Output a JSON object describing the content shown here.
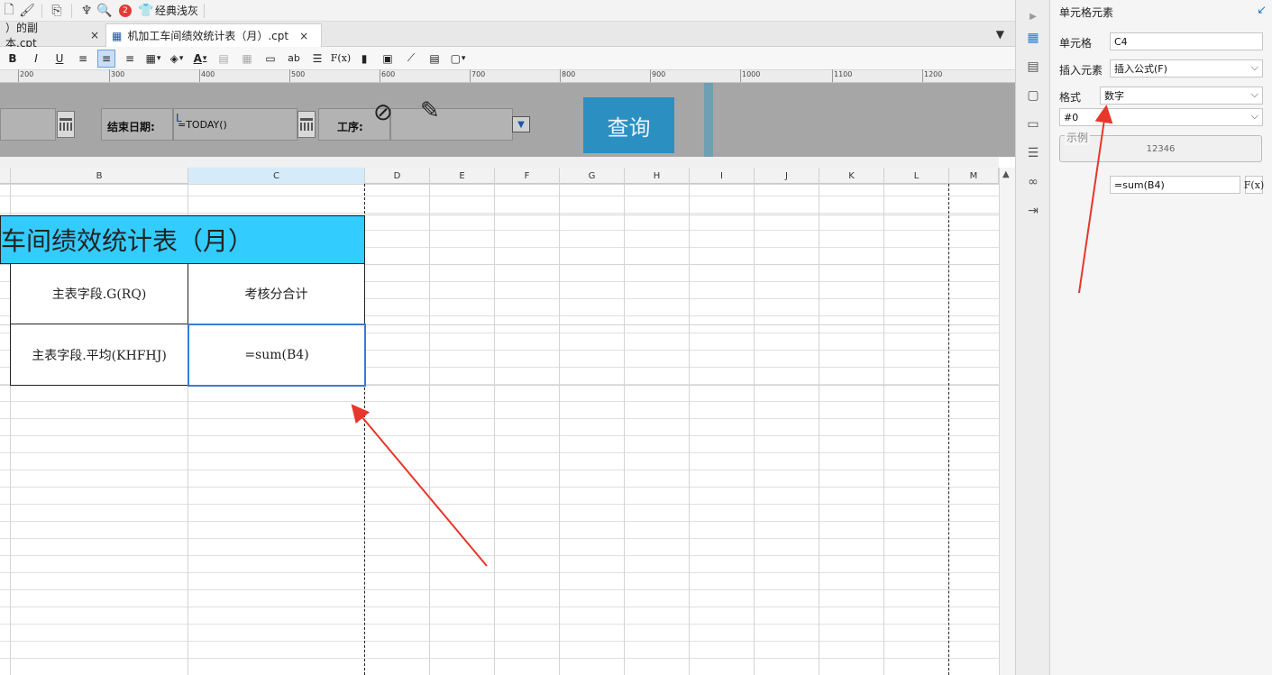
{
  "toolbar": {
    "badge_count": "2",
    "theme_label": "经典浅灰",
    "icons": [
      "new-file-icon",
      "brush-icon",
      "preview-icon",
      "plugin-icon",
      "search-icon",
      "shirt-icon"
    ]
  },
  "tabs": [
    {
      "label": "）的副本.cpt",
      "close": "×"
    },
    {
      "label": "机加工车间绩效统计表（月）.cpt",
      "close": "×"
    }
  ],
  "format_toolbar": {
    "bold": "B",
    "italic": "I",
    "underline": "U",
    "font_color": "A",
    "text_label": "ab",
    "formula": "F(x)"
  },
  "ruler": {
    "labels": [
      "200",
      "300",
      "400",
      "500",
      "600",
      "700",
      "800",
      "900",
      "1000",
      "1100",
      "1200"
    ]
  },
  "parameters": {
    "end_date_label": "结束日期:",
    "end_date_value": "=TODAY()",
    "process_label": "工序:",
    "query_button": "查询"
  },
  "columns": [
    "B",
    "C",
    "D",
    "E",
    "F",
    "G",
    "H",
    "I",
    "J",
    "K",
    "L",
    "M"
  ],
  "sheet": {
    "title": "车间绩效统计表（月）",
    "header_b": "主表字段.G(RQ)",
    "header_c": "考核分合计",
    "row_b": "主表字段.平均(KHFHJ)",
    "row_c": "=sum(B4)"
  },
  "panel": {
    "title": "单元格元素",
    "cell_label": "单元格",
    "cell_value": "C4",
    "insert_label": "插入元素",
    "insert_value": "插入公式(F)",
    "format_label": "格式",
    "format_value": "数字",
    "pattern_value": "#0",
    "sample_label": "示例",
    "sample_value": "12346",
    "formula_value": "=sum(B4)",
    "fx_label": "F(x)"
  },
  "colors": {
    "title_fill": "#33CCFF",
    "selection": "#3A7BD5",
    "query_button": "#2B8FC2",
    "annotation_arrow": "#E8362B"
  }
}
